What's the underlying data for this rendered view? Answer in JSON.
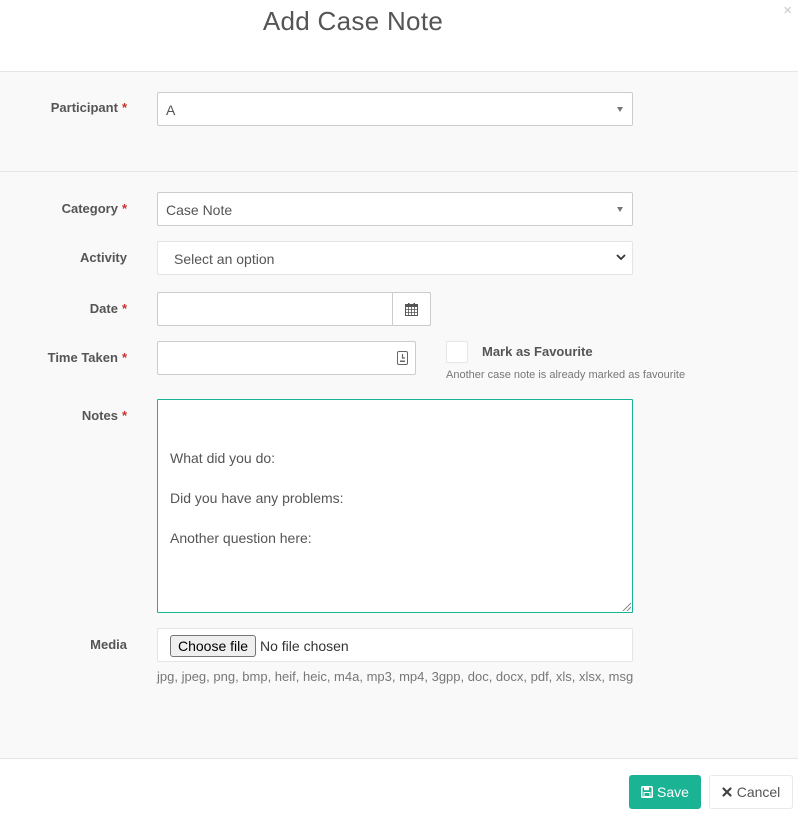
{
  "modal": {
    "title": "Add Case Note",
    "close_glyph": "×"
  },
  "required_mark": "*",
  "participant": {
    "label": "Participant",
    "value": "A"
  },
  "category": {
    "label": "Category",
    "value": "Case Note"
  },
  "activity": {
    "label": "Activity",
    "value": "Select an option"
  },
  "date": {
    "label": "Date",
    "value": ""
  },
  "time_taken": {
    "label": "Time Taken",
    "value": ""
  },
  "favourite": {
    "label": "Mark as Favourite",
    "checked": false,
    "hint": "Another case note is already marked as favourite"
  },
  "notes": {
    "label": "Notes",
    "lines": [
      "What did you do:",
      "",
      "Did you have any problems:",
      "",
      "Another question here:"
    ]
  },
  "media": {
    "label": "Media",
    "button": "Choose file",
    "status": "No file chosen",
    "allowed_types": "jpg, jpeg, png, bmp, heif, heic, m4a, mp3, mp4, 3gpp, doc, docx, pdf, xls, xlsx, msg"
  },
  "footer": {
    "save": "Save",
    "cancel": "Cancel"
  },
  "colors": {
    "accent": "#1ab394",
    "required": "#c9302c"
  },
  "icons": {
    "dropdown": "caret-down-icon",
    "select": "chevron-down-icon",
    "date": "calendar-icon",
    "time": "clock-icon",
    "save": "floppy-disk-icon",
    "cancel": "close-icon"
  }
}
